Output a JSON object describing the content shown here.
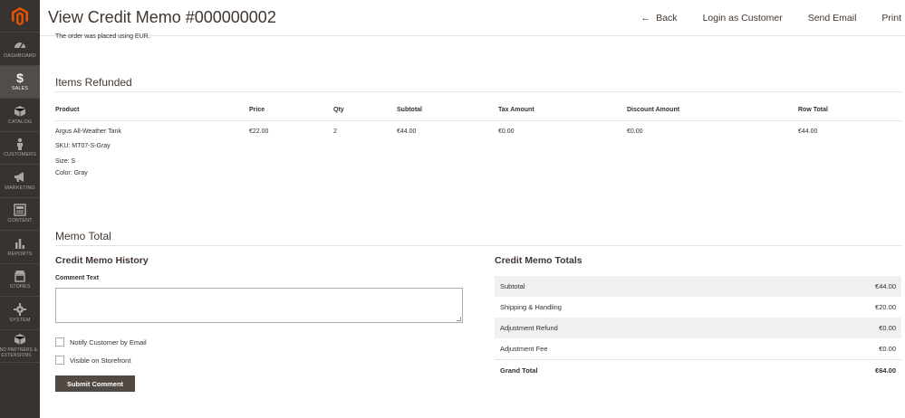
{
  "sidebar": {
    "items": [
      {
        "label": "DASHBOARD",
        "icon": "dashboard-icon"
      },
      {
        "label": "SALES",
        "icon": "dollar-icon",
        "glyph": "$",
        "active": true
      },
      {
        "label": "CATALOG",
        "icon": "cube-icon"
      },
      {
        "label": "CUSTOMERS",
        "icon": "person-icon"
      },
      {
        "label": "MARKETING",
        "icon": "megaphone-icon"
      },
      {
        "label": "CONTENT",
        "icon": "content-icon"
      },
      {
        "label": "REPORTS",
        "icon": "bar-chart-icon"
      },
      {
        "label": "STORES",
        "icon": "store-icon"
      },
      {
        "label": "SYSTEM",
        "icon": "gear-icon"
      },
      {
        "label": "FIND PARTNERS & EXTENSIONS",
        "icon": "extensions-icon"
      }
    ]
  },
  "header": {
    "title": "View Credit Memo #000000002",
    "back_label": "Back",
    "back_glyph": "←",
    "login_label": "Login as Customer",
    "email_label": "Send Email",
    "print_label": "Print"
  },
  "note": "The order was placed using EUR.",
  "items_refunded": {
    "title": "Items Refunded",
    "headers": [
      "Product",
      "Price",
      "Qty",
      "Subtotal",
      "Tax Amount",
      "Discount Amount",
      "Row Total"
    ],
    "rows": [
      {
        "product": "Argus All-Weather Tank",
        "sku": "SKU: MT07-S-Gray",
        "size": "Size: S",
        "color": "Color: Gray",
        "price": "€22.00",
        "qty": "2",
        "subtotal": "€44.00",
        "tax": "€0.00",
        "discount": "€0.00",
        "row_total": "€44.00"
      }
    ]
  },
  "memo_total": {
    "title": "Memo Total",
    "history": {
      "title": "Credit Memo History",
      "comment_label": "Comment Text",
      "comment_value": "",
      "notify_label": "Notify Customer by Email",
      "notify_checked": false,
      "visible_label": "Visible on Storefront",
      "visible_checked": false,
      "submit_label": "Submit Comment"
    },
    "totals": {
      "title": "Credit Memo Totals",
      "rows": [
        {
          "label": "Subtotal",
          "value": "€44.00"
        },
        {
          "label": "Shipping & Handling",
          "value": "€20.00"
        },
        {
          "label": "Adjustment Refund",
          "value": "€0.00"
        },
        {
          "label": "Adjustment Fee",
          "value": "€0.00"
        }
      ],
      "grand_label": "Grand Total",
      "grand_value": "€64.00"
    }
  },
  "colors": {
    "sidebar_bg": "#373330",
    "sidebar_active": "#524d49",
    "logo_orange": "#eb5202",
    "button_bg": "#514943"
  }
}
